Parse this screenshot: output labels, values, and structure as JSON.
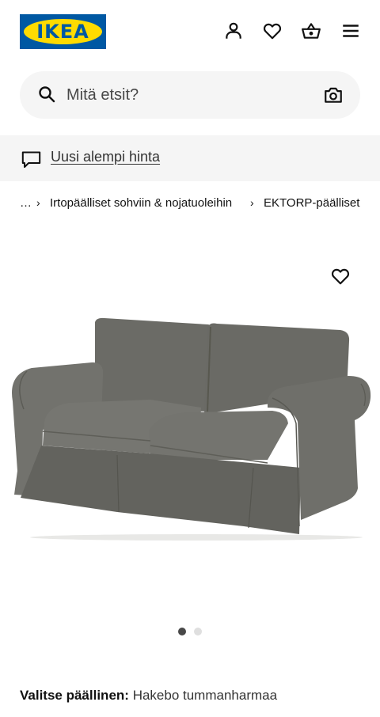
{
  "header": {
    "logo_text": "IKEA",
    "icons": [
      "account-icon",
      "wishlist-heart-icon",
      "shopping-basket-icon",
      "menu-icon"
    ]
  },
  "search": {
    "placeholder": "Mitä etsit?",
    "icons": [
      "search-icon",
      "camera-search-icon"
    ]
  },
  "promo": {
    "link_text": "Uusi alempi hinta",
    "icon": "chat-bubble-icon"
  },
  "breadcrumb": {
    "items": [
      "…",
      "Irtopäälliset sohviin & nojatuoleihin",
      "EKTORP-päälliset"
    ]
  },
  "gallery": {
    "image_count": 2,
    "active_index": 0,
    "favorite_icon": "heart-icon"
  },
  "variant": {
    "label": "Valitse päällinen:",
    "value": "Hakebo tummanharmaa"
  },
  "colors": {
    "brand_blue": "#0058a3",
    "brand_yellow": "#ffdb00",
    "sofa_gray": "#6e6e69",
    "dot_active": "#484848",
    "dot_inactive": "#dfdfdf"
  }
}
